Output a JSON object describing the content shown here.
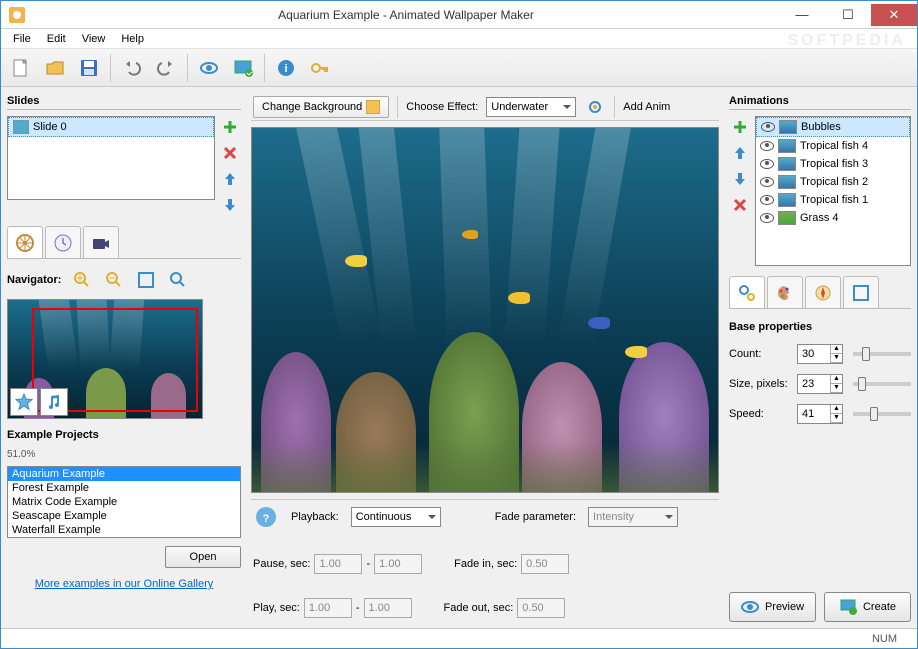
{
  "window": {
    "title": "Aquarium Example - Animated Wallpaper Maker"
  },
  "menubar": [
    "File",
    "Edit",
    "View",
    "Help"
  ],
  "slides": {
    "header": "Slides",
    "items": [
      "Slide 0"
    ]
  },
  "navigator": {
    "label": "Navigator:"
  },
  "examples": {
    "header": "Example Projects",
    "percent": "51.0%",
    "items": [
      "Aquarium Example",
      "Forest Example",
      "Matrix Code Example",
      "Seascape Example",
      "Waterfall Example"
    ],
    "open": "Open",
    "link": "More examples in our Online Gallery"
  },
  "centerbar": {
    "change_bg": "Change Background",
    "choose_effect": "Choose Effect:",
    "effect_value": "Underwater",
    "add_anim": "Add Anim"
  },
  "playback": {
    "help": "?",
    "label": "Playback:",
    "mode": "Continuous",
    "pause": "Pause, sec:",
    "play": "Play, sec:",
    "pause1": "1.00",
    "pause2": "1.00",
    "play1": "1.00",
    "play2": "1.00",
    "fade_param": "Fade parameter:",
    "fade_param_val": "Intensity",
    "fade_in": "Fade in, sec:",
    "fade_in_val": "0.50",
    "fade_out": "Fade out, sec:",
    "fade_out_val": "0.50",
    "dash": "-"
  },
  "animations": {
    "header": "Animations",
    "items": [
      "Bubbles",
      "Tropical fish 4",
      "Tropical fish 3",
      "Tropical fish 2",
      "Tropical fish 1",
      "Grass 4"
    ]
  },
  "props": {
    "header": "Base properties",
    "count": "Count:",
    "count_v": "30",
    "size": "Size, pixels:",
    "size_v": "23",
    "speed": "Speed:",
    "speed_v": "41"
  },
  "actions": {
    "preview": "Preview",
    "create": "Create"
  },
  "status": {
    "num": "NUM"
  }
}
